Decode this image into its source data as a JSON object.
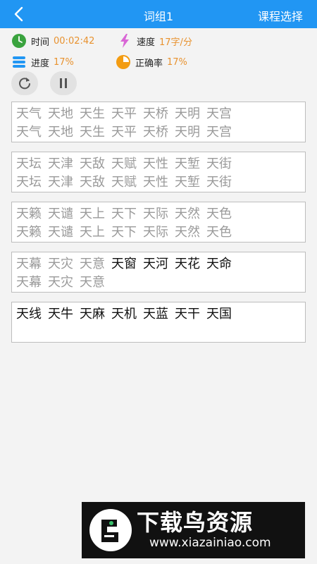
{
  "header": {
    "title": "词组1",
    "course_select": "课程选择"
  },
  "stats": {
    "time_label": "时间",
    "time_value": "00:02:42",
    "speed_label": "速度",
    "speed_value": "17字/分",
    "progress_label": "进度",
    "progress_value": "17%",
    "accuracy_label": "正确率",
    "accuracy_value": "17%"
  },
  "colors": {
    "header": "#2196f3",
    "value_accent": "#e8922f",
    "time_icon": "#3aa33e",
    "speed_icon": "#d966d6",
    "progress_icon": "#2196f3",
    "accuracy_icon": "#f39c12"
  },
  "icons": {
    "back": "back-arrow-icon",
    "time": "clock-icon",
    "speed": "lightning-icon",
    "progress": "list-icon",
    "accuracy": "pie-chart-icon",
    "refresh": "refresh-icon",
    "pause": "pause-icon"
  },
  "boxes": [
    {
      "target": [
        "天气",
        "天地",
        "天生",
        "天平",
        "天桥",
        "天明",
        "天宫"
      ],
      "typed": [
        "天气",
        "天地",
        "天生",
        "天平",
        "天桥",
        "天明",
        "天宫"
      ],
      "current_from": 7
    },
    {
      "target": [
        "天坛",
        "天津",
        "天敌",
        "天赋",
        "天性",
        "天堑",
        "天街"
      ],
      "typed": [
        "天坛",
        "天津",
        "天敌",
        "天赋",
        "天性",
        "天堑",
        "天街"
      ],
      "current_from": 7
    },
    {
      "target": [
        "天籁",
        "天谴",
        "天上",
        "天下",
        "天际",
        "天然",
        "天色"
      ],
      "typed": [
        "天籁",
        "天谴",
        "天上",
        "天下",
        "天际",
        "天然",
        "天色"
      ],
      "current_from": 7
    },
    {
      "target": [
        "天幕",
        "天灾",
        "天意",
        "天窗",
        "天河",
        "天花",
        "天命"
      ],
      "typed": [
        "天幕",
        "天灾",
        "天意"
      ],
      "current_from": 3
    },
    {
      "target": [
        "天线",
        "天牛",
        "天麻",
        "天机",
        "天蓝",
        "天干",
        "天国"
      ],
      "typed": [],
      "current_from": 0
    }
  ],
  "watermark": {
    "title": "下载鸟资源",
    "url": "www.xiazainiao.com"
  }
}
